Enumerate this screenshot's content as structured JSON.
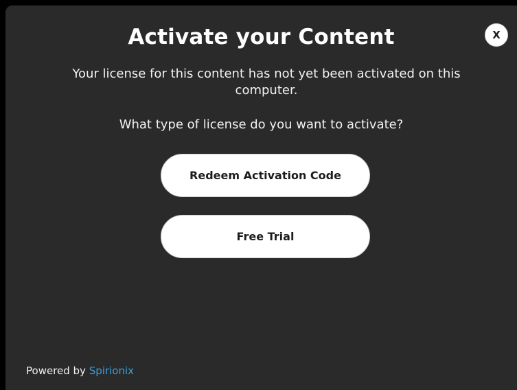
{
  "dialog": {
    "title": "Activate your Content",
    "close_label": "X",
    "message": "Your license for this content has not yet been activated on this computer.",
    "question": "What type of license do you want to activate?",
    "buttons": {
      "redeem_label": "Redeem Activation Code",
      "trial_label": "Free Trial"
    }
  },
  "footer": {
    "powered_by": "Powered by",
    "brand": "Spirionix"
  },
  "colors": {
    "background": "#000000",
    "dialog_bg": "#2a2a2a",
    "text": "#ffffff",
    "button_bg": "#ffffff",
    "button_text": "#1c1c1c",
    "brand_link": "#3a9fd6"
  },
  "icons": {
    "close": "close-icon"
  }
}
